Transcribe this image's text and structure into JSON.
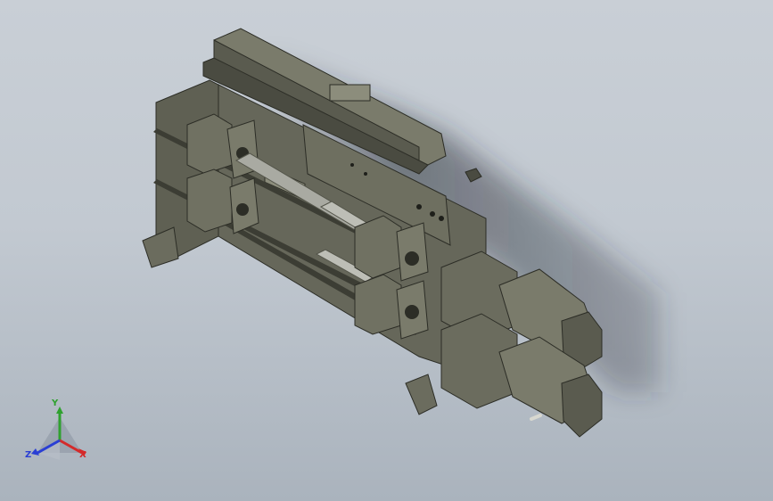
{
  "viewport": {
    "background_top": "#c9cfd6",
    "background_bottom": "#aab3bd"
  },
  "model": {
    "body_color": "#6b6c5e",
    "dark_color": "#3c3d34",
    "light_color": "#8c8d7c",
    "rod_color": "#a9aaa2"
  },
  "triad": {
    "x_label": "X",
    "y_label": "Y",
    "z_label": "Z",
    "x_color": "#d42a2a",
    "y_color": "#2fa12f",
    "z_color": "#2a3fd4"
  }
}
